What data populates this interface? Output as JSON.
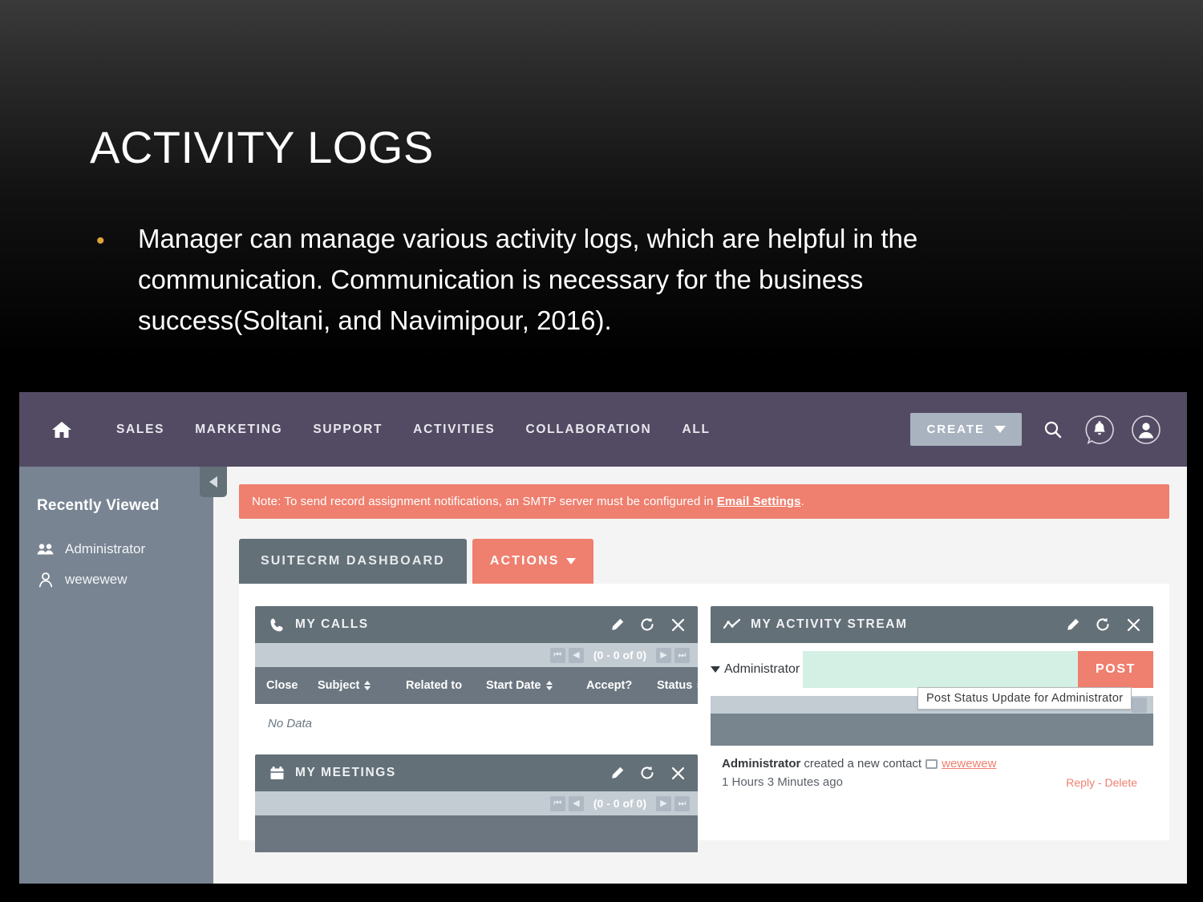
{
  "slide": {
    "title": "ACTIVITY LOGS",
    "bullet_marker": "•",
    "bullet_text": "Manager can manage various activity logs, which are helpful in the communication. Communication is necessary for the business success(Soltani, and Navimipour, 2016).",
    "accent_bullet_color": "#e0a23b",
    "background_color": "#000000"
  },
  "crm": {
    "navbar": {
      "home_icon": "home-icon",
      "links": [
        {
          "label": "SALES"
        },
        {
          "label": "MARKETING"
        },
        {
          "label": "SUPPORT"
        },
        {
          "label": "ACTIVITIES"
        },
        {
          "label": "COLLABORATION"
        },
        {
          "label": "ALL"
        }
      ],
      "create_label": "CREATE",
      "search_icon": "search-icon",
      "notification_icon": "notification-bell-icon",
      "profile_icon": "user-profile-icon",
      "background_color": "#534b63",
      "create_button_color": "#a9b3bf"
    },
    "sidebar": {
      "heading": "Recently Viewed",
      "background_color": "#788492",
      "collapse_icon": "collapse-left-icon",
      "items": [
        {
          "label": "Administrator",
          "icon": "users-group-icon"
        },
        {
          "label": "wewewew",
          "icon": "user-icon"
        }
      ]
    },
    "banner": {
      "text_before": "Note: To send record assignment notifications, an SMTP server must be configured in ",
      "link_label": "Email Settings",
      "text_after": ".",
      "background_color": "#ef7f6e"
    },
    "tabs": {
      "dashboard_label": "SUITECRM DASHBOARD",
      "actions_label": "ACTIONS",
      "actions_color": "#ef7f6e",
      "dashboard_color": "#647078"
    },
    "dashlets": {
      "my_calls": {
        "title": "MY CALLS",
        "icon": "phone-icon",
        "edit_icon": "pencil-icon",
        "refresh_icon": "refresh-icon",
        "close_icon": "close-icon",
        "pager": {
          "first": "⏮",
          "prev": "◀",
          "count": "(0 - 0 of 0)",
          "next": "▶",
          "last": "⏭"
        },
        "columns": [
          {
            "label": "Close",
            "sortable": false
          },
          {
            "label": "Subject",
            "sortable": true
          },
          {
            "label": "Related to",
            "sortable": false
          },
          {
            "label": "Start Date",
            "sortable": true
          },
          {
            "label": "Accept?",
            "sortable": false
          },
          {
            "label": "Status",
            "sortable": true
          }
        ],
        "empty_text": "No Data"
      },
      "my_meetings": {
        "title": "MY MEETINGS",
        "icon": "calendar-icon",
        "edit_icon": "pencil-icon",
        "refresh_icon": "refresh-icon",
        "close_icon": "close-icon",
        "pager": {
          "first": "⏮",
          "prev": "◀",
          "count": "(0 - 0 of 0)",
          "next": "▶",
          "last": "⏭"
        }
      },
      "my_activity_stream": {
        "title": "MY ACTIVITY STREAM",
        "icon": "activity-chart-icon",
        "edit_icon": "pencil-icon",
        "refresh_icon": "refresh-icon",
        "close_icon": "close-icon",
        "user_label": "Administrator",
        "input_value": "",
        "input_placeholder": "",
        "post_label": "POST",
        "tooltip": "Post Status Update for  Administrator",
        "input_background": "#d4f0e5",
        "post_button_color": "#ef7f6e",
        "entry": {
          "actor": "Administrator",
          "action": "created a new contact",
          "target": "wewewew",
          "target_icon": "contact-record-icon",
          "time": "1 Hours 3 Minutes ago",
          "reply_label": "Reply",
          "separator": "-",
          "delete_label": "Delete"
        }
      }
    }
  }
}
